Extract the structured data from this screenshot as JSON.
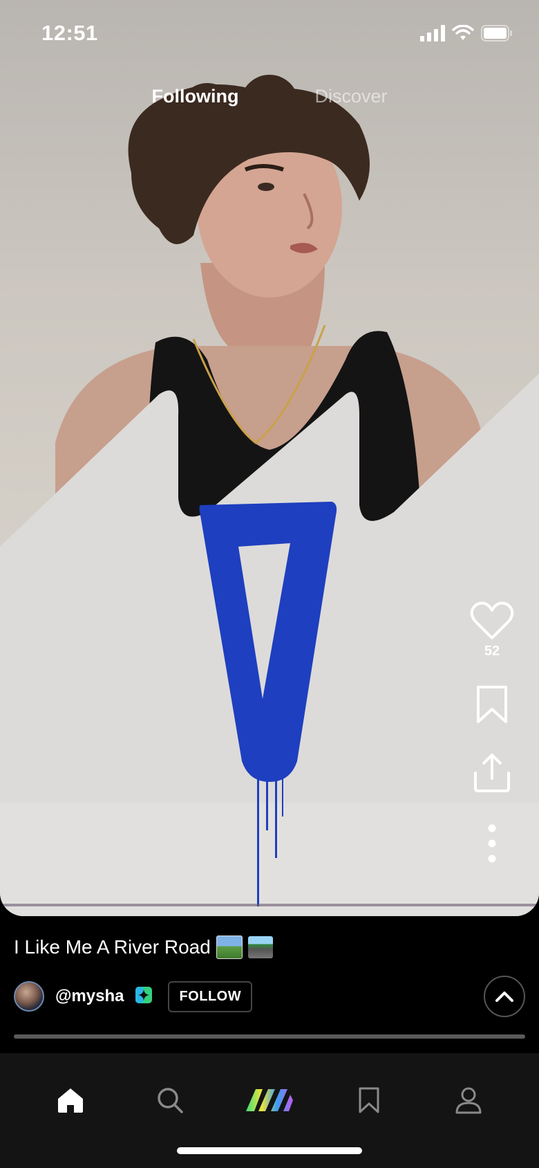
{
  "status_bar": {
    "time": "12:51"
  },
  "top_tabs": [
    {
      "label": "Following",
      "active": true
    },
    {
      "label": "Discover",
      "active": false
    }
  ],
  "actions": {
    "like_count": "52"
  },
  "post": {
    "title": "I Like Me A River Road",
    "title_emojis": [
      "landscape-photo-emoji",
      "highway-emoji"
    ],
    "author_handle": "@mysha",
    "follow_label": "FOLLOW",
    "progress": 1.0
  },
  "bottom_nav": [
    {
      "name": "home-icon",
      "active": true
    },
    {
      "name": "search-icon",
      "active": false
    },
    {
      "name": "app-logo-icon",
      "active": false
    },
    {
      "name": "bookmark-icon",
      "active": false
    },
    {
      "name": "profile-icon",
      "active": false
    }
  ],
  "colors": {
    "background": "#000000",
    "nav_background": "#141414",
    "graffiti_blue": "#1e3fbf",
    "verified_badge": "#35d07f"
  }
}
